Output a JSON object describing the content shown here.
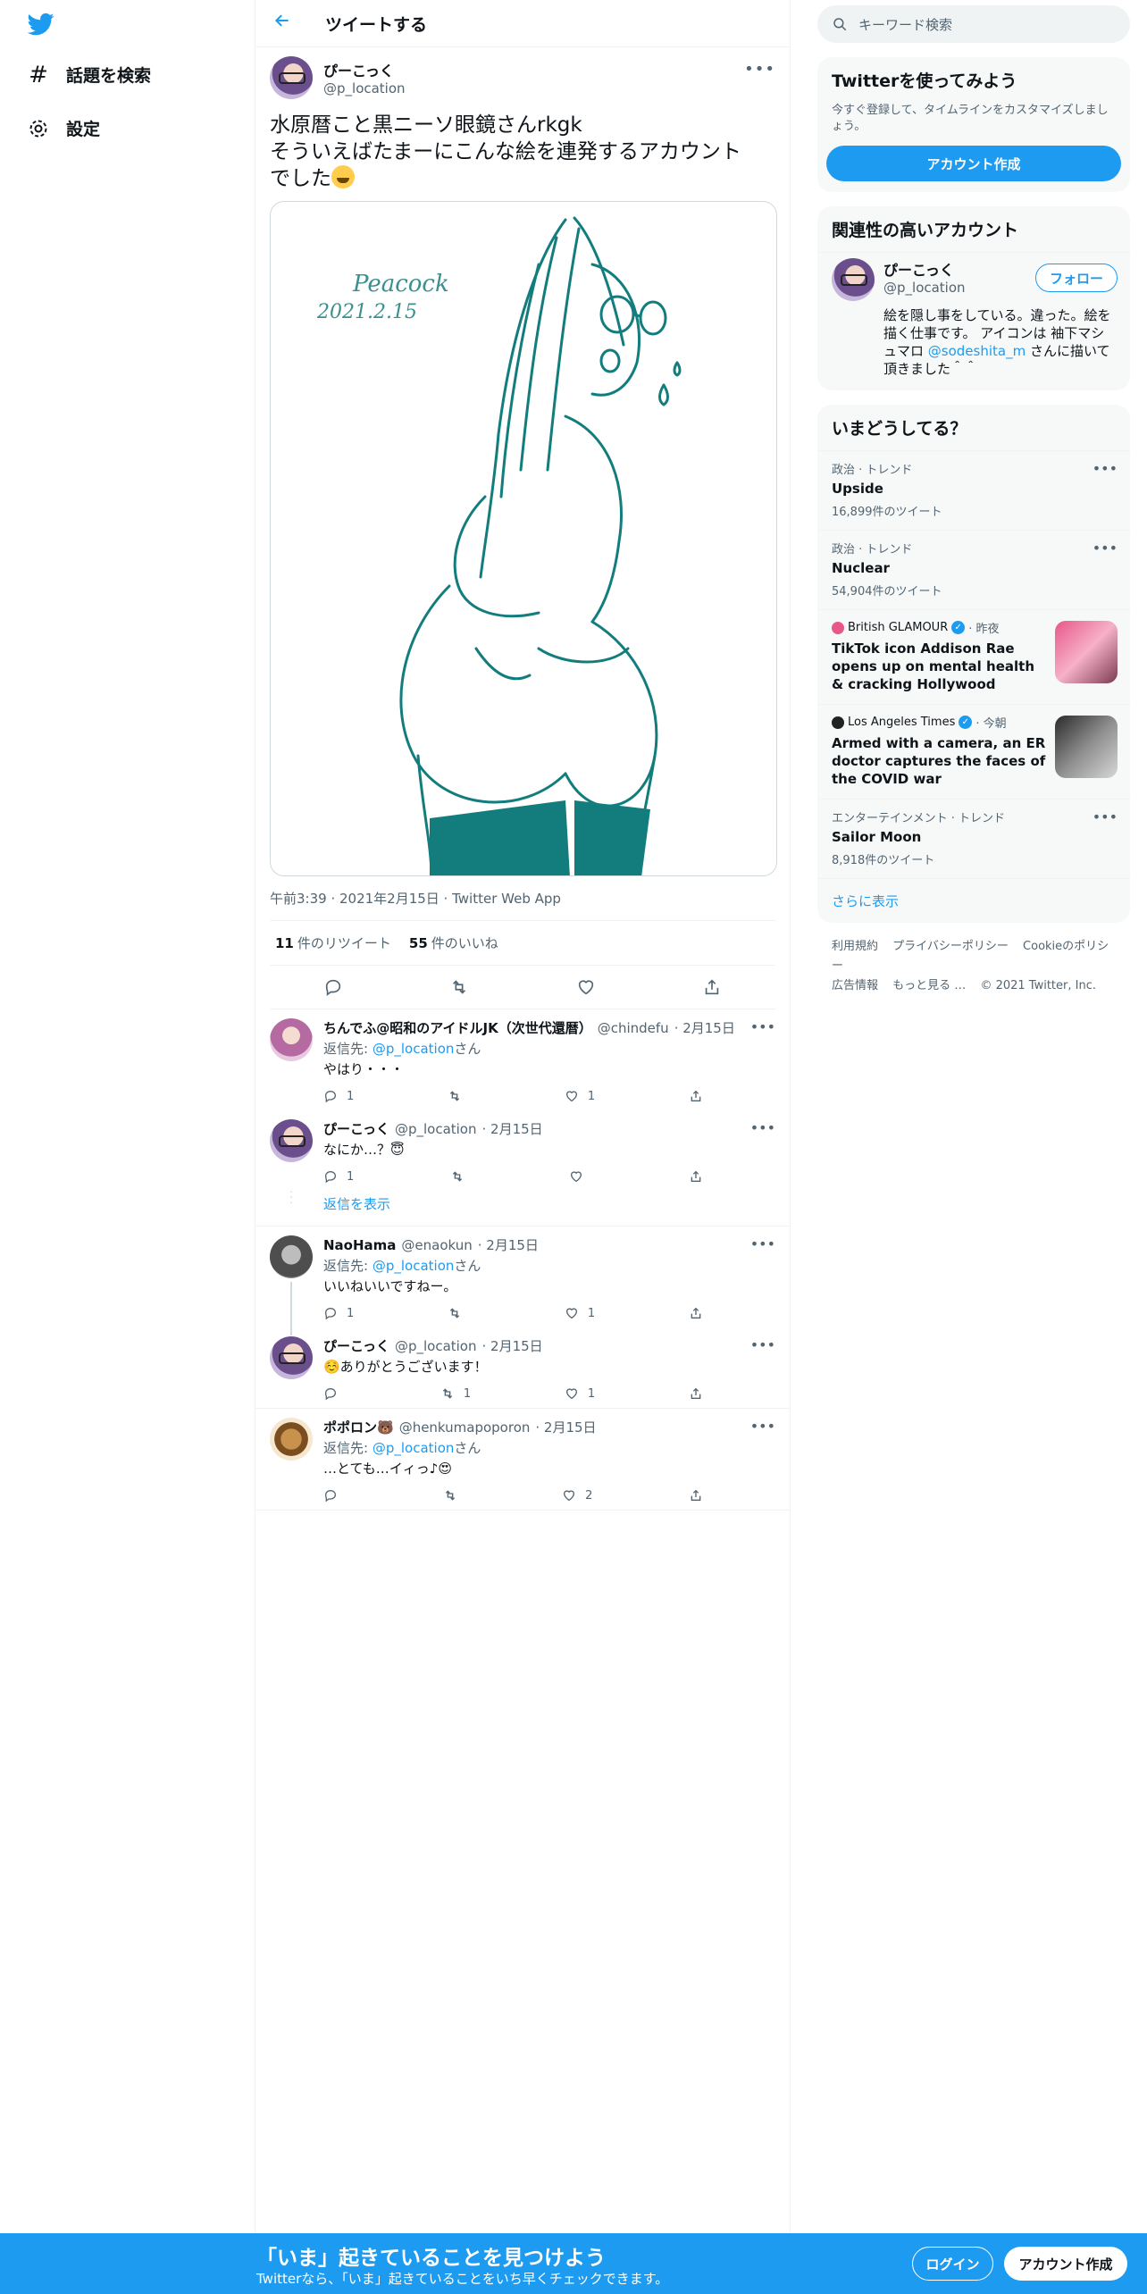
{
  "nav": {
    "explore_label": "話題を検索",
    "settings_label": "設定"
  },
  "header": {
    "title": "ツイートする"
  },
  "main_tweet": {
    "display_name": "ぴーこっく",
    "handle": "@p_location",
    "text": "水原暦こと黒ニーソ眼鏡さんrkgk\nそういえばたまーにこんな絵を連発するアカウント\nでした",
    "image_signature": "Peacock",
    "image_date": "2021.2.15",
    "meta": "午前3:39 · 2021年2月15日 · Twitter Web App",
    "retweets": "11",
    "retweets_label": "件のリツイート",
    "likes": "55",
    "likes_label": "件のいいね"
  },
  "replies": [
    {
      "display_name": "ちんでふ@昭和のアイドルJK（次世代還暦）",
      "handle": "@chindefu",
      "date": "· 2月15日",
      "reply_prefix": "返信先:",
      "reply_to": "@p_location",
      "reply_suffix": "さん",
      "text": "やはり・・・",
      "reply_count": "1",
      "retweet_count": "",
      "like_count": "1"
    },
    {
      "display_name": "ぴーこっく",
      "handle": "@p_location",
      "date": "· 2月15日",
      "text": "なにか…？😇",
      "reply_count": "1",
      "retweet_count": "",
      "like_count": ""
    },
    {
      "display_name": "NaoHama",
      "handle": "@enaokun",
      "date": "· 2月15日",
      "reply_prefix": "返信先:",
      "reply_to": "@p_location",
      "reply_suffix": "さん",
      "text": "いいねいいですねー。",
      "reply_count": "1",
      "retweet_count": "",
      "like_count": "1"
    },
    {
      "display_name": "ぴーこっく",
      "handle": "@p_location",
      "date": "· 2月15日",
      "text": "☺️ありがとうございます！",
      "reply_count": "",
      "retweet_count": "1",
      "like_count": "1"
    },
    {
      "display_name": "ポポロン🐻",
      "handle": "@henkumapoporon",
      "date": "· 2月15日",
      "reply_prefix": "返信先:",
      "reply_to": "@p_location",
      "reply_suffix": "さん",
      "text": "…とても…イィっ♪😍",
      "reply_count": "",
      "retweet_count": "",
      "like_count": "2"
    }
  ],
  "show_replies_label": "返信を表示",
  "sidebar": {
    "search_placeholder": "キーワード検索",
    "signup_card": {
      "title": "Twitterを使ってみよう",
      "desc": "今すぐ登録して、タイムラインをカスタマイズしましょう。",
      "button": "アカウント作成"
    },
    "relevant": {
      "title": "関連性の高いアカウント",
      "display_name": "ぴーこっく",
      "handle": "@p_location",
      "follow": "フォロー",
      "bio_before": "絵を隠し事をしている。違った。絵を描く仕事です。 アイコンは 袖下マシュマロ ",
      "bio_link": "@sodeshita_m",
      "bio_after": " さんに描いて頂きました＾＾"
    },
    "trends": {
      "title": "いまどうしてる？",
      "items": [
        {
          "meta": "政治 · トレンド",
          "name": "Upside",
          "count": "16,899件のツイート"
        },
        {
          "meta": "政治 · トレンド",
          "name": "Nuclear",
          "count": "54,904件のツイート"
        }
      ],
      "news": [
        {
          "source": "British GLAMOUR",
          "time": "· 昨夜",
          "title": "TikTok icon Addison Rae opens up on mental health & cracking Hollywood"
        },
        {
          "source": "Los Angeles Times",
          "time": "· 今朝",
          "title": "Armed with a camera, an ER doctor captures the faces of the COVID war"
        }
      ],
      "last": {
        "meta": "エンターテインメント · トレンド",
        "name": "Sailor Moon",
        "count": "8,918件のツイート"
      },
      "show_more": "さらに表示"
    },
    "footer": {
      "links": [
        "利用規約",
        "プライバシーポリシー",
        "Cookieのポリシー",
        "広告情報",
        "もっと見る …"
      ],
      "copyright": "© 2021 Twitter, Inc."
    }
  },
  "bottom_bar": {
    "title": "「いま」起きていることを見つけよう",
    "subtitle": "Twitterなら、「いま」起きていることをいち早くチェックできます。",
    "login": "ログイン",
    "signup": "アカウント作成"
  }
}
